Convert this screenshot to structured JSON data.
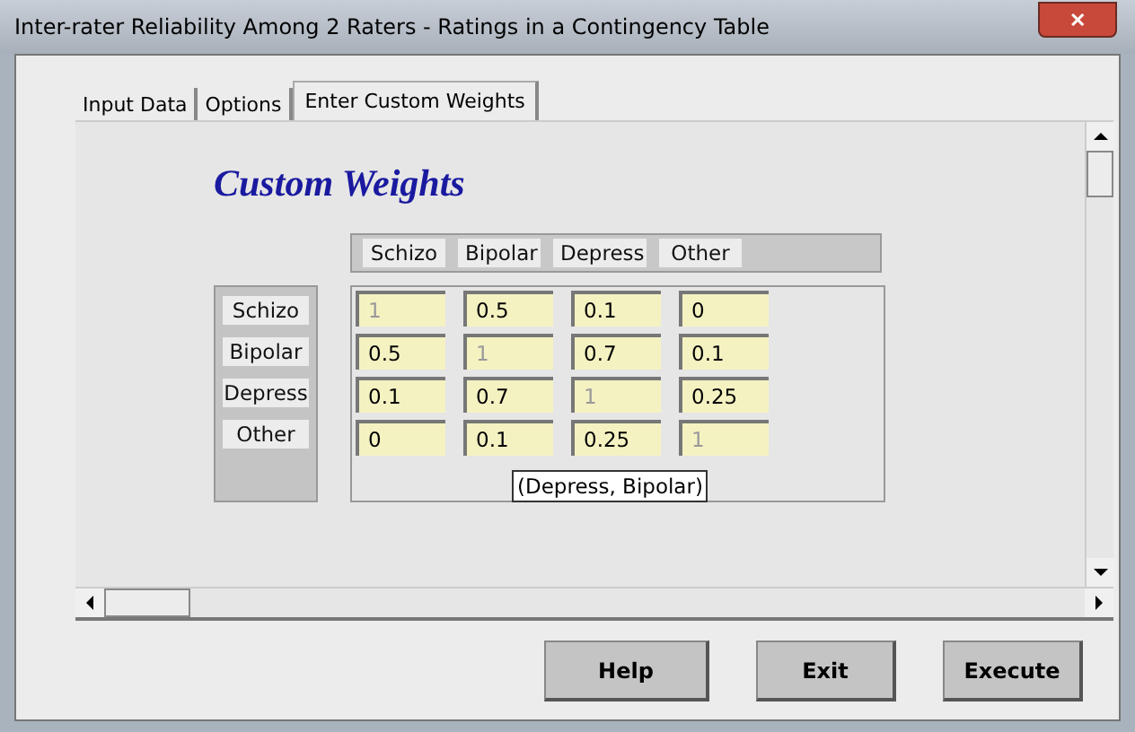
{
  "window": {
    "title": "Inter-rater Reliability Among 2 Raters - Ratings in a  Contingency Table",
    "close": "✕"
  },
  "tabs": [
    {
      "label": "Input Data",
      "selected": false
    },
    {
      "label": "Options",
      "selected": false
    },
    {
      "label": "Enter Custom Weights",
      "selected": true
    }
  ],
  "heading": "Custom Weights",
  "columns": [
    "Schizo",
    "Bipolar",
    "Depress",
    "Other"
  ],
  "rows": [
    {
      "label": "Schizo",
      "cells": [
        {
          "value": "1",
          "disabled": true
        },
        {
          "value": "0.5",
          "disabled": false
        },
        {
          "value": "0.1",
          "disabled": false
        },
        {
          "value": "0",
          "disabled": false
        }
      ]
    },
    {
      "label": "Bipolar",
      "cells": [
        {
          "value": "0.5",
          "disabled": false
        },
        {
          "value": "1",
          "disabled": true
        },
        {
          "value": "0.7",
          "disabled": false
        },
        {
          "value": "0.1",
          "disabled": false
        }
      ]
    },
    {
      "label": "Depress",
      "cells": [
        {
          "value": "0.1",
          "disabled": false
        },
        {
          "value": "0.7",
          "disabled": false
        },
        {
          "value": "1",
          "disabled": true
        },
        {
          "value": "0.25",
          "disabled": false
        }
      ]
    },
    {
      "label": "Other",
      "cells": [
        {
          "value": "0",
          "disabled": false
        },
        {
          "value": "0.1",
          "disabled": false
        },
        {
          "value": "0.25",
          "disabled": false
        },
        {
          "value": "1",
          "disabled": true
        }
      ]
    }
  ],
  "tooltip": "(Depress, Bipolar)",
  "buttons": [
    "Help",
    "Exit",
    "Execute"
  ]
}
